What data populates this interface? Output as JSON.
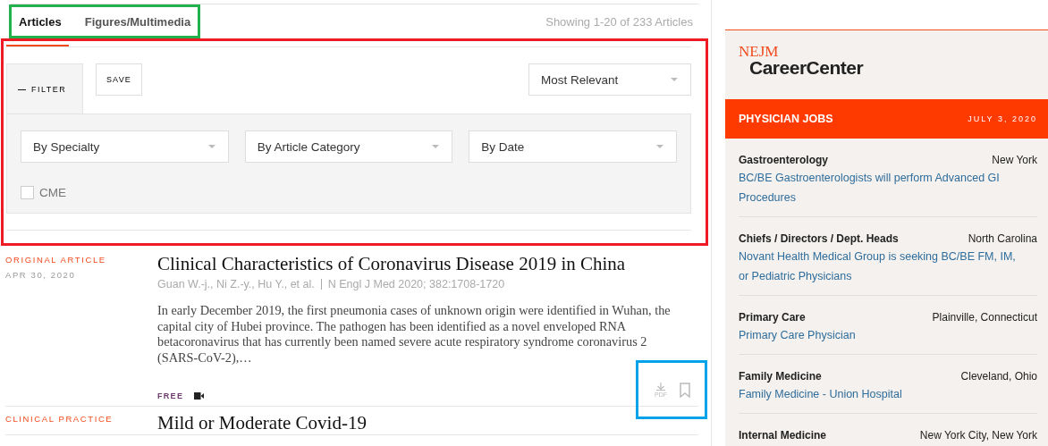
{
  "tabs": [
    {
      "label": "Articles",
      "selected": true
    },
    {
      "label": "Figures/Multimedia",
      "selected": false
    }
  ],
  "result_count": "Showing 1-20 of 233 Articles",
  "filter": {
    "toggle_icon": "—",
    "toggle_label": "FILTER",
    "expanded": true,
    "save_label": "SAVE",
    "sort": "Most Relevant",
    "dropdowns": [
      "By Specialty",
      "By Article Category",
      "By Date"
    ],
    "cme": {
      "label": "CME",
      "checked": false
    }
  },
  "articles": [
    {
      "category": "ORIGINAL ARTICLE",
      "date": "APR 30, 2020",
      "title": "Clinical Characteristics of Coronavirus Disease 2019 in China",
      "authors": "Guan W.-j., Ni Z.-y., Hu Y., et al.",
      "citation": "N Engl J Med 2020; 382:1708-1720",
      "abstract": "In early December 2019, the first pneumonia cases of unknown origin were identified in Wuhan, the capital city of Hubei province. The pathogen has been identified as a novel enveloped RNA betacoronavirus that has currently been named severe acute respiratory syndrome coronavirus 2 (SARS-CoV-2),…",
      "access": "FREE",
      "has_video": true,
      "pdf_label": "PDF"
    },
    {
      "category": "CLINICAL PRACTICE",
      "title": "Mild or Moderate Covid-19"
    }
  ],
  "highlights": [
    {
      "color": "#22b14c"
    },
    {
      "color": "#ed1c24"
    },
    {
      "color": "#00a2e8"
    }
  ],
  "career": {
    "logo_top": "NEJM",
    "logo_bottom": "CareerCenter",
    "heading": "PHYSICIAN JOBS",
    "date": "JULY 3, 2020",
    "jobs": [
      {
        "specialty": "Gastroenterology",
        "location": "New York",
        "title": "BC/BE Gastroenterologists will perform Advanced GI Procedures"
      },
      {
        "specialty": "Chiefs / Directors / Dept. Heads",
        "location": "North Carolina",
        "title": "Novant Health Medical Group is seeking BC/BE FM, IM, or Pediatric Physicians"
      },
      {
        "specialty": "Primary Care",
        "location": "Plainville, Connecticut",
        "title": "Primary Care Physician"
      },
      {
        "specialty": "Family Medicine",
        "location": "Cleveland, Ohio",
        "title": "Family Medicine - Union Hospital"
      },
      {
        "specialty": "Internal Medicine",
        "location": "New York City, New York"
      }
    ]
  }
}
